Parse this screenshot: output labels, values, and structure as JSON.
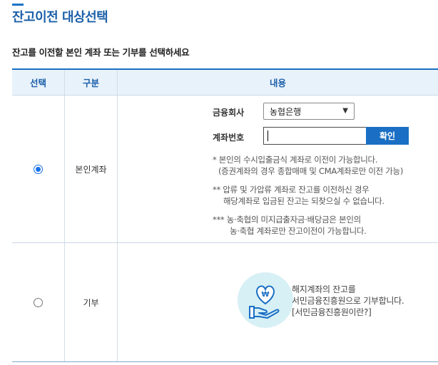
{
  "page": {
    "title": "잔고이전 대상선택",
    "subtitle": "잔고를 이전할 본인 계좌 또는 기부를 선택하세요"
  },
  "table": {
    "headers": [
      "선택",
      "구분",
      "내용"
    ],
    "row1": {
      "type_label": "본인계좌",
      "selected": true,
      "bank_label": "금융회사",
      "bank_value": "농협은행",
      "account_label": "계좌번호",
      "account_value": "",
      "confirm_label": "확인",
      "notes": [
        "* 본인의 수시입출금식 계좌로 이전이 가능합니다.",
        "(증권계좌의 경우 종합매매 및 CMA계좌로만 이전 가능)",
        "** 압류 및 가압류 계좌로 잔고를 이전하신 경우",
        "해당계좌로 입금된 잔고는 되찾으실 수 없습니다.",
        "*** 농·축협의 미지급출자금·배당금은 본인의",
        "농·축협 계좌로만 잔고이전이 가능합니다."
      ]
    },
    "row2": {
      "type_label": "기부",
      "selected": false,
      "donate_lines": [
        "해지계좌의 잔고를",
        "서민금융진흥원으로 기부합니다.",
        "[서민금융진흥원이란?]"
      ],
      "icon": "donation-hand-heart-icon"
    }
  },
  "colors": {
    "accent": "#1a6fc4",
    "title": "#1a5fa8",
    "header_bg": "#e8f2fb",
    "icon_bg": "#d7f0f5"
  }
}
